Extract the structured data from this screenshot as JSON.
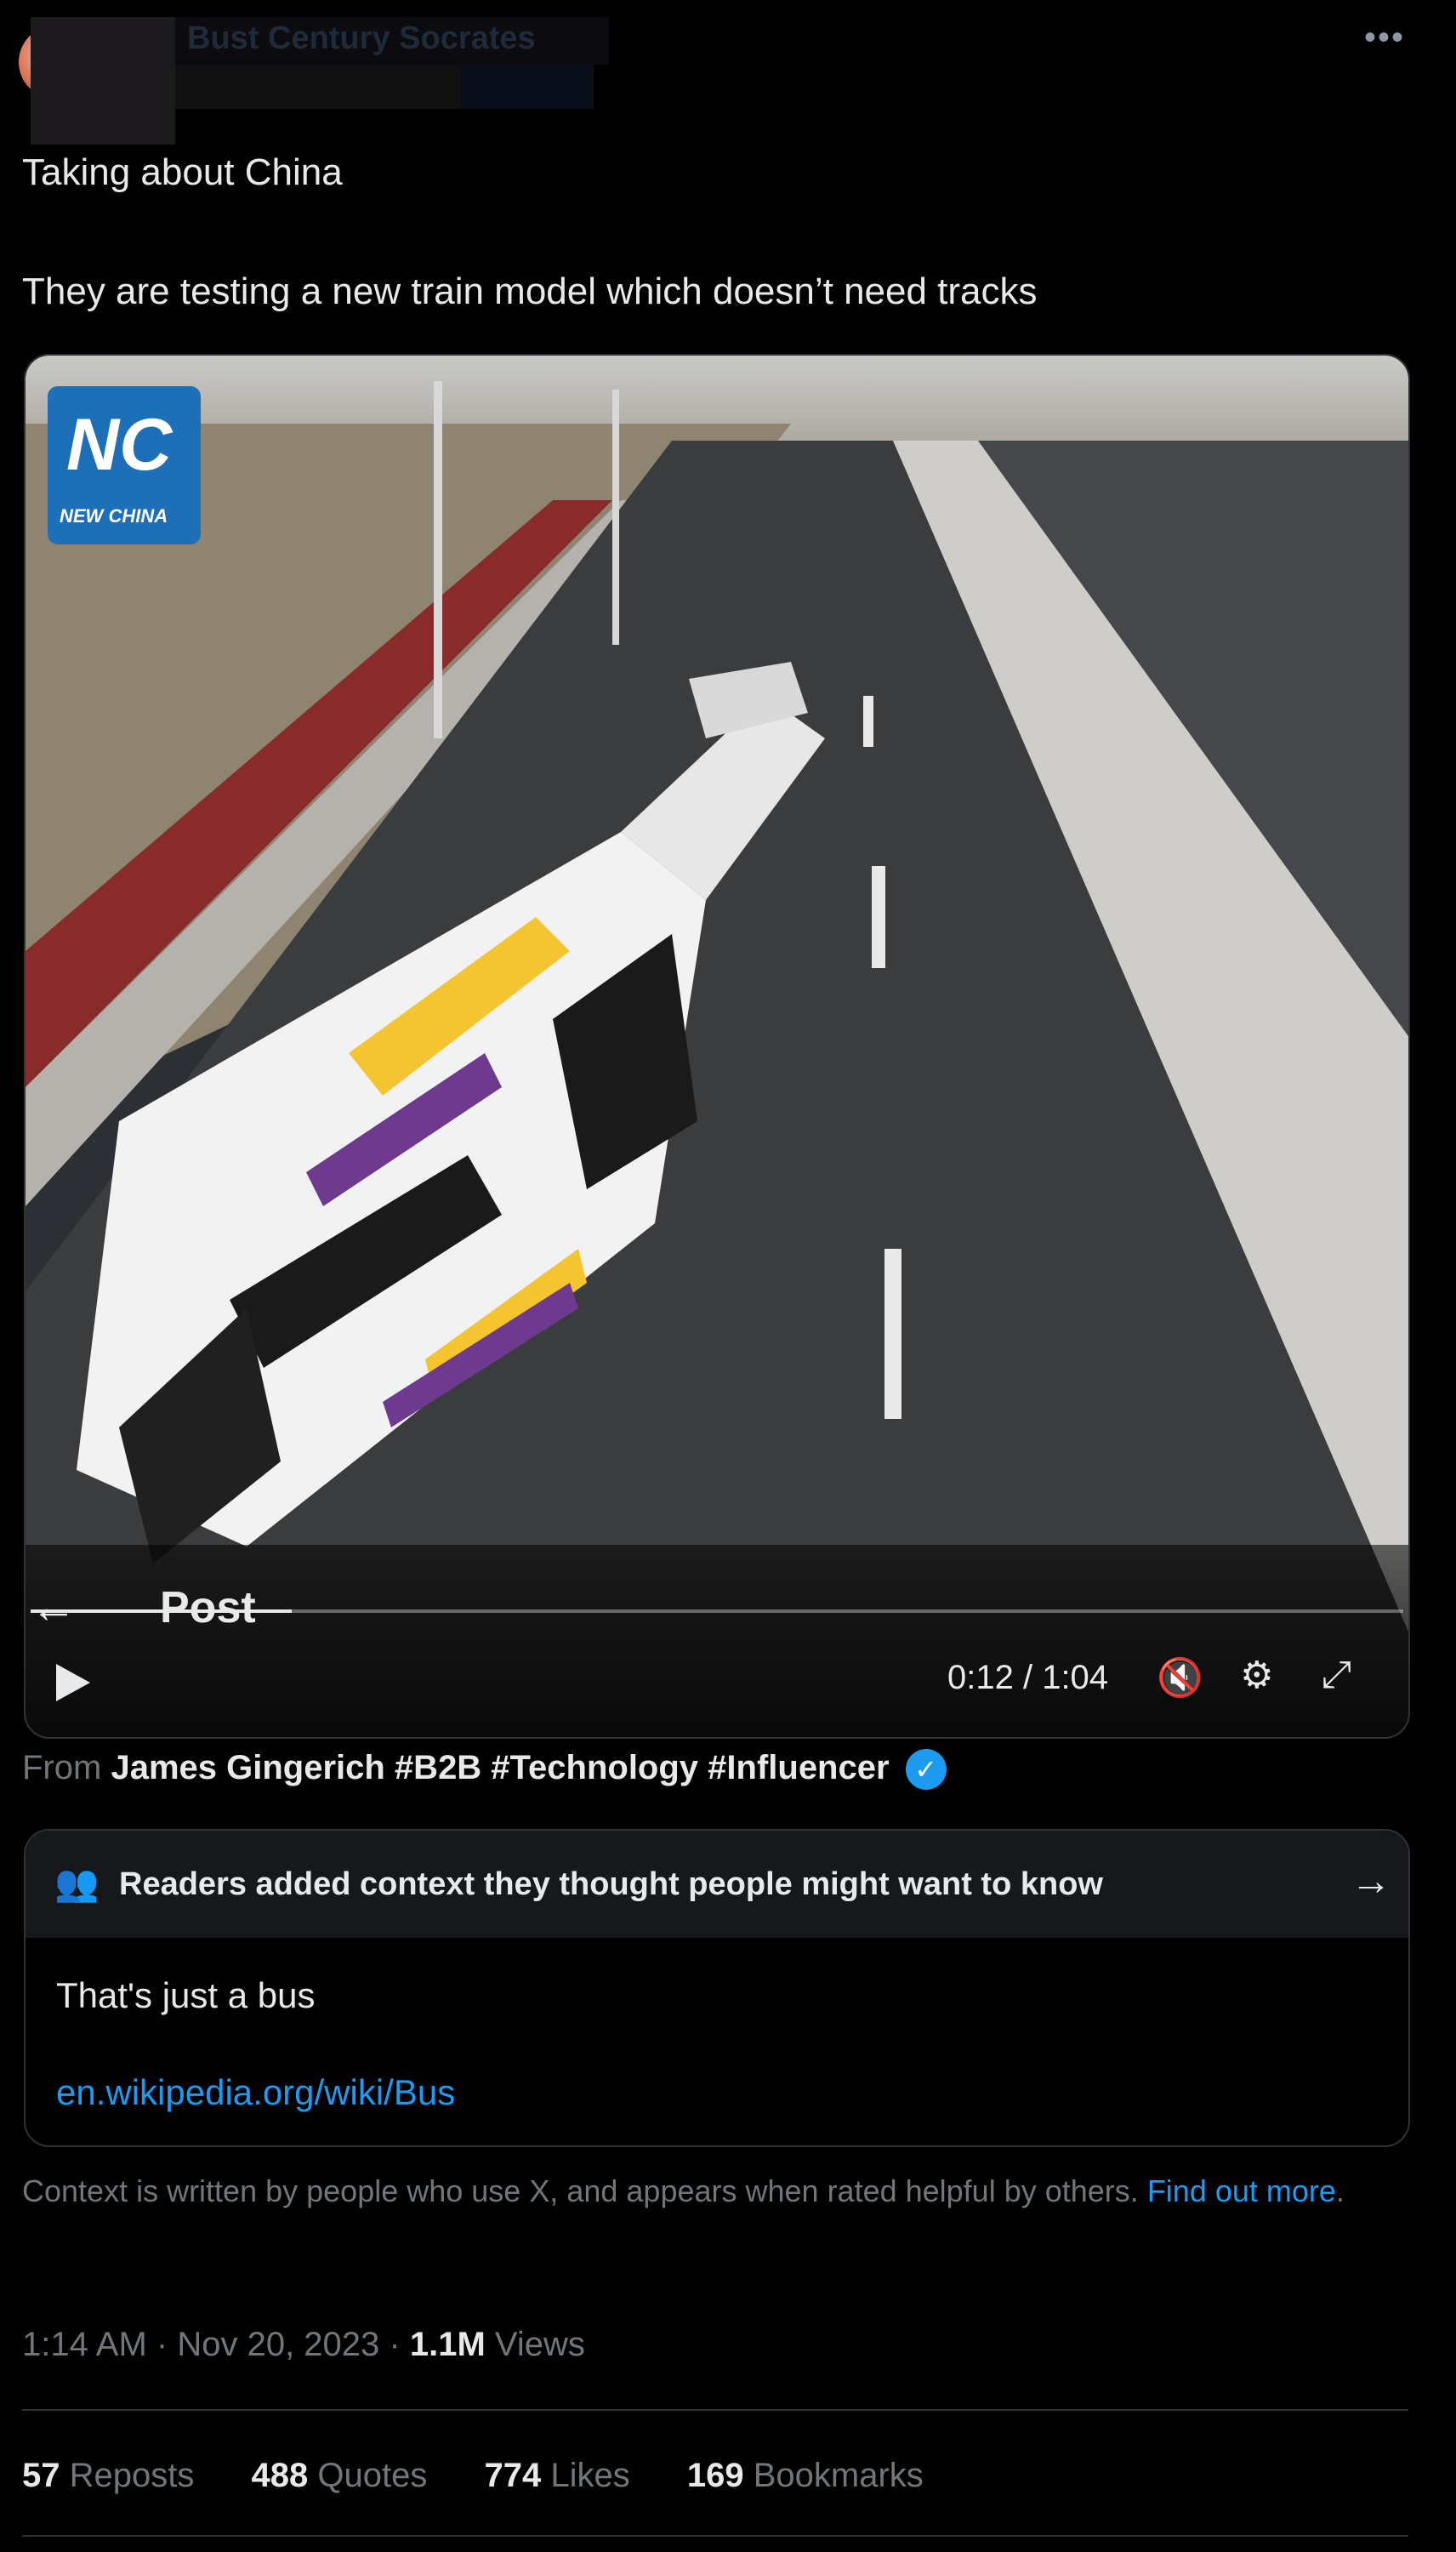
{
  "header": {
    "author_name": "Bust Century Socrates",
    "more_icon": "more-dots-icon"
  },
  "tweet": {
    "line1": "Taking about China",
    "line2": "They are testing a new train model which doesn’t need tracks"
  },
  "video": {
    "watermark_text": "NEW CHINA",
    "watermark_mark": "NC",
    "overlay_back_label": "Post",
    "current_time": "0:12",
    "duration": "1:04",
    "time_display": "0:12 / 1:04",
    "progress": 0.19,
    "icons": [
      "play-icon",
      "mute-icon",
      "settings-gear-icon",
      "fullscreen-icon"
    ]
  },
  "from": {
    "prefix": "From",
    "account": "James Gingerich #B2B #Technology #Influencer"
  },
  "community_note": {
    "header": "Readers added context they thought people might want to know",
    "body": "That's just a bus",
    "link": "en.wikipedia.org/wiki/Bus"
  },
  "context_notice": {
    "text": "Context is written by people who use X, and appears when rated helpful by others.",
    "link": "Find out more"
  },
  "meta": {
    "time": "1:14 AM",
    "date": "Nov 20, 2023",
    "views_count": "1.1M",
    "views_label": "Views"
  },
  "stats": [
    {
      "count": "57",
      "label": "Reposts"
    },
    {
      "count": "488",
      "label": "Quotes"
    },
    {
      "count": "774",
      "label": "Likes"
    },
    {
      "count": "169",
      "label": "Bookmarks"
    }
  ],
  "colors": {
    "background": "#000000",
    "accent": "#1d9bf0",
    "muted": "#71767b",
    "text": "#e7e9ea"
  }
}
